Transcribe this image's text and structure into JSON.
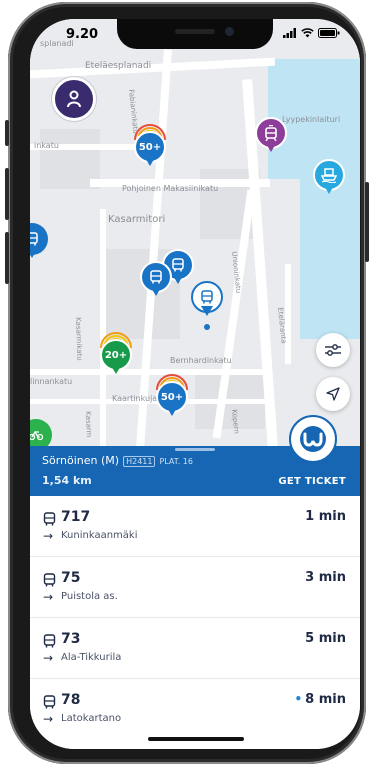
{
  "status": {
    "time": "9.20"
  },
  "map": {
    "labels": {
      "esplanadi": "splanadi",
      "etelaesplanadi": "Eteläesplanadi",
      "fabianinkatu": "Fabianinkatu",
      "lyypekinlaituri": "Lyypekinlaituri",
      "inkatu": "inkatu",
      "pohjoinen_makasiinikatu": "Pohjoinen Makasiinikatu",
      "kasarmitori": "Kasarmitori",
      "unioninkatu": "Unioninkatu",
      "etelaranta": "Eteläranta",
      "kasarmikatu": "Kasarmikatu",
      "bernhardinkatu": "Bernhardinkatu",
      "linnankatu": "linnankatu",
      "kaartinkuja": "Kaartinkuja",
      "kasarmi_short": "Kasarm",
      "kopernikus": "Kopern"
    },
    "pins": {
      "bike1": "50+",
      "bike2": "20+",
      "bike3": "50+"
    },
    "colors": {
      "bus": "#1a74c5",
      "tram": "#8d3d9a",
      "ferry": "#27a8df",
      "bike_green": "#179b4b"
    }
  },
  "banner": {
    "stop_name": "Sörnöinen (M)",
    "stop_code": "H2411",
    "platform": "PLAT. 16",
    "distance": "1,54 km",
    "ticket_label": "GET TICKET"
  },
  "departures": [
    {
      "route": "717",
      "destination": "Kuninkaanmäki",
      "eta": "1 min",
      "realtime": false
    },
    {
      "route": "75",
      "destination": "Puistola as.",
      "eta": "3 min",
      "realtime": false
    },
    {
      "route": "73",
      "destination": "Ala-Tikkurila",
      "eta": "5 min",
      "realtime": false
    },
    {
      "route": "78",
      "destination": "Latokartano",
      "eta": "8 min",
      "realtime": true
    }
  ],
  "icons": [
    "avatar-icon",
    "tram-icon",
    "ferry-icon",
    "bus-icon",
    "filter-icon",
    "locate-icon",
    "bike-icon",
    "app-logo-icon",
    "arrow-right-icon"
  ]
}
